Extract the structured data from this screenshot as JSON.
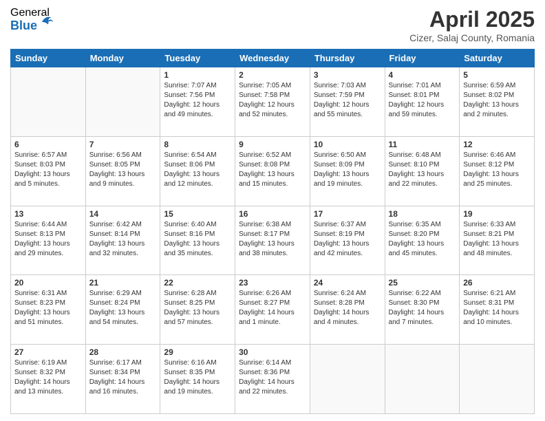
{
  "header": {
    "logo_general": "General",
    "logo_blue": "Blue",
    "month_title": "April 2025",
    "location": "Cizer, Salaj County, Romania"
  },
  "days_of_week": [
    "Sunday",
    "Monday",
    "Tuesday",
    "Wednesday",
    "Thursday",
    "Friday",
    "Saturday"
  ],
  "weeks": [
    [
      {
        "day": "",
        "sunrise": "",
        "sunset": "",
        "daylight": ""
      },
      {
        "day": "",
        "sunrise": "",
        "sunset": "",
        "daylight": ""
      },
      {
        "day": "1",
        "sunrise": "Sunrise: 7:07 AM",
        "sunset": "Sunset: 7:56 PM",
        "daylight": "Daylight: 12 hours and 49 minutes."
      },
      {
        "day": "2",
        "sunrise": "Sunrise: 7:05 AM",
        "sunset": "Sunset: 7:58 PM",
        "daylight": "Daylight: 12 hours and 52 minutes."
      },
      {
        "day": "3",
        "sunrise": "Sunrise: 7:03 AM",
        "sunset": "Sunset: 7:59 PM",
        "daylight": "Daylight: 12 hours and 55 minutes."
      },
      {
        "day": "4",
        "sunrise": "Sunrise: 7:01 AM",
        "sunset": "Sunset: 8:01 PM",
        "daylight": "Daylight: 12 hours and 59 minutes."
      },
      {
        "day": "5",
        "sunrise": "Sunrise: 6:59 AM",
        "sunset": "Sunset: 8:02 PM",
        "daylight": "Daylight: 13 hours and 2 minutes."
      }
    ],
    [
      {
        "day": "6",
        "sunrise": "Sunrise: 6:57 AM",
        "sunset": "Sunset: 8:03 PM",
        "daylight": "Daylight: 13 hours and 5 minutes."
      },
      {
        "day": "7",
        "sunrise": "Sunrise: 6:56 AM",
        "sunset": "Sunset: 8:05 PM",
        "daylight": "Daylight: 13 hours and 9 minutes."
      },
      {
        "day": "8",
        "sunrise": "Sunrise: 6:54 AM",
        "sunset": "Sunset: 8:06 PM",
        "daylight": "Daylight: 13 hours and 12 minutes."
      },
      {
        "day": "9",
        "sunrise": "Sunrise: 6:52 AM",
        "sunset": "Sunset: 8:08 PM",
        "daylight": "Daylight: 13 hours and 15 minutes."
      },
      {
        "day": "10",
        "sunrise": "Sunrise: 6:50 AM",
        "sunset": "Sunset: 8:09 PM",
        "daylight": "Daylight: 13 hours and 19 minutes."
      },
      {
        "day": "11",
        "sunrise": "Sunrise: 6:48 AM",
        "sunset": "Sunset: 8:10 PM",
        "daylight": "Daylight: 13 hours and 22 minutes."
      },
      {
        "day": "12",
        "sunrise": "Sunrise: 6:46 AM",
        "sunset": "Sunset: 8:12 PM",
        "daylight": "Daylight: 13 hours and 25 minutes."
      }
    ],
    [
      {
        "day": "13",
        "sunrise": "Sunrise: 6:44 AM",
        "sunset": "Sunset: 8:13 PM",
        "daylight": "Daylight: 13 hours and 29 minutes."
      },
      {
        "day": "14",
        "sunrise": "Sunrise: 6:42 AM",
        "sunset": "Sunset: 8:14 PM",
        "daylight": "Daylight: 13 hours and 32 minutes."
      },
      {
        "day": "15",
        "sunrise": "Sunrise: 6:40 AM",
        "sunset": "Sunset: 8:16 PM",
        "daylight": "Daylight: 13 hours and 35 minutes."
      },
      {
        "day": "16",
        "sunrise": "Sunrise: 6:38 AM",
        "sunset": "Sunset: 8:17 PM",
        "daylight": "Daylight: 13 hours and 38 minutes."
      },
      {
        "day": "17",
        "sunrise": "Sunrise: 6:37 AM",
        "sunset": "Sunset: 8:19 PM",
        "daylight": "Daylight: 13 hours and 42 minutes."
      },
      {
        "day": "18",
        "sunrise": "Sunrise: 6:35 AM",
        "sunset": "Sunset: 8:20 PM",
        "daylight": "Daylight: 13 hours and 45 minutes."
      },
      {
        "day": "19",
        "sunrise": "Sunrise: 6:33 AM",
        "sunset": "Sunset: 8:21 PM",
        "daylight": "Daylight: 13 hours and 48 minutes."
      }
    ],
    [
      {
        "day": "20",
        "sunrise": "Sunrise: 6:31 AM",
        "sunset": "Sunset: 8:23 PM",
        "daylight": "Daylight: 13 hours and 51 minutes."
      },
      {
        "day": "21",
        "sunrise": "Sunrise: 6:29 AM",
        "sunset": "Sunset: 8:24 PM",
        "daylight": "Daylight: 13 hours and 54 minutes."
      },
      {
        "day": "22",
        "sunrise": "Sunrise: 6:28 AM",
        "sunset": "Sunset: 8:25 PM",
        "daylight": "Daylight: 13 hours and 57 minutes."
      },
      {
        "day": "23",
        "sunrise": "Sunrise: 6:26 AM",
        "sunset": "Sunset: 8:27 PM",
        "daylight": "Daylight: 14 hours and 1 minute."
      },
      {
        "day": "24",
        "sunrise": "Sunrise: 6:24 AM",
        "sunset": "Sunset: 8:28 PM",
        "daylight": "Daylight: 14 hours and 4 minutes."
      },
      {
        "day": "25",
        "sunrise": "Sunrise: 6:22 AM",
        "sunset": "Sunset: 8:30 PM",
        "daylight": "Daylight: 14 hours and 7 minutes."
      },
      {
        "day": "26",
        "sunrise": "Sunrise: 6:21 AM",
        "sunset": "Sunset: 8:31 PM",
        "daylight": "Daylight: 14 hours and 10 minutes."
      }
    ],
    [
      {
        "day": "27",
        "sunrise": "Sunrise: 6:19 AM",
        "sunset": "Sunset: 8:32 PM",
        "daylight": "Daylight: 14 hours and 13 minutes."
      },
      {
        "day": "28",
        "sunrise": "Sunrise: 6:17 AM",
        "sunset": "Sunset: 8:34 PM",
        "daylight": "Daylight: 14 hours and 16 minutes."
      },
      {
        "day": "29",
        "sunrise": "Sunrise: 6:16 AM",
        "sunset": "Sunset: 8:35 PM",
        "daylight": "Daylight: 14 hours and 19 minutes."
      },
      {
        "day": "30",
        "sunrise": "Sunrise: 6:14 AM",
        "sunset": "Sunset: 8:36 PM",
        "daylight": "Daylight: 14 hours and 22 minutes."
      },
      {
        "day": "",
        "sunrise": "",
        "sunset": "",
        "daylight": ""
      },
      {
        "day": "",
        "sunrise": "",
        "sunset": "",
        "daylight": ""
      },
      {
        "day": "",
        "sunrise": "",
        "sunset": "",
        "daylight": ""
      }
    ]
  ]
}
